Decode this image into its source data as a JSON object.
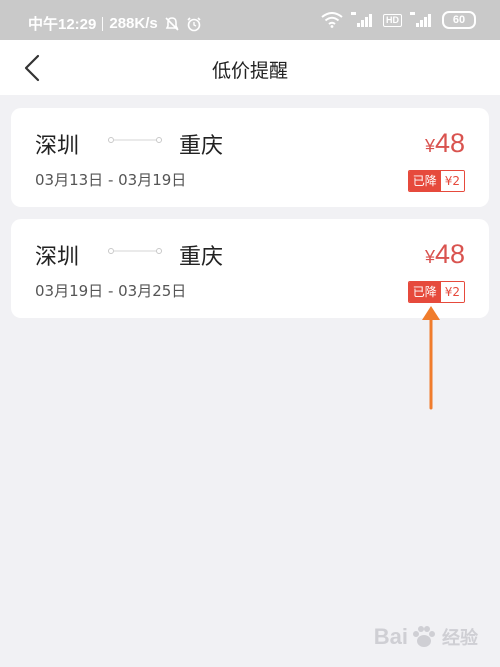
{
  "status_bar": {
    "time": "中午12:29",
    "network_speed": "288K/s",
    "hd_label": "HD",
    "battery": "60"
  },
  "nav": {
    "title": "低价提醒"
  },
  "alerts": [
    {
      "from": "深圳",
      "to": "重庆",
      "dates": "03月13日 - 03月19日",
      "currency": "¥",
      "price": "48",
      "drop_label": "已降",
      "drop_amount": "¥2"
    },
    {
      "from": "深圳",
      "to": "重庆",
      "dates": "03月19日 - 03月25日",
      "currency": "¥",
      "price": "48",
      "drop_label": "已降",
      "drop_amount": "¥2"
    }
  ],
  "watermark": {
    "brand_left": "Bai",
    "brand_right": "经验"
  },
  "colors": {
    "accent_red": "#e64a3c",
    "price_red": "#d9534f",
    "annotation_arrow": "#f07c2c"
  }
}
